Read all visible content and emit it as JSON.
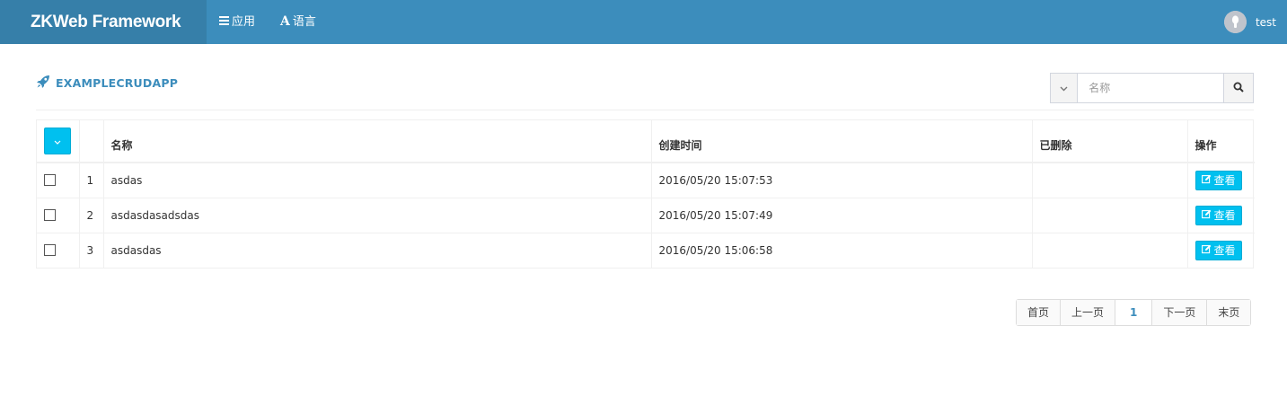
{
  "navbar": {
    "brand": "ZKWeb Framework",
    "apps_label": "应用",
    "language_label": "语言",
    "language_glyph": "A",
    "user_name": "test",
    "colors": {
      "navbar": "#3c8dbc",
      "brand_bg": "#367fa9"
    }
  },
  "page": {
    "title": "EXAMPLECRUDAPP",
    "title_icon": "rocket-icon"
  },
  "search": {
    "placeholder": "名称",
    "dropdown_icon": "chevron-down-icon",
    "button_icon": "search-icon"
  },
  "table": {
    "columns": [
      "",
      "",
      "名称",
      "创建时间",
      "已删除",
      "操作"
    ],
    "rows": [
      {
        "index": "1",
        "name": "asdas",
        "created": "2016/05/20 15:07:53",
        "deleted": "",
        "action": "查看"
      },
      {
        "index": "2",
        "name": "asdasdasadsdas",
        "created": "2016/05/20 15:07:49",
        "deleted": "",
        "action": "查看"
      },
      {
        "index": "3",
        "name": "asdasdas",
        "created": "2016/05/20 15:06:58",
        "deleted": "",
        "action": "查看"
      }
    ],
    "accent": "#00c0ef"
  },
  "pagination": {
    "first": "首页",
    "prev": "上一页",
    "current": "1",
    "next": "下一页",
    "last": "末页"
  }
}
